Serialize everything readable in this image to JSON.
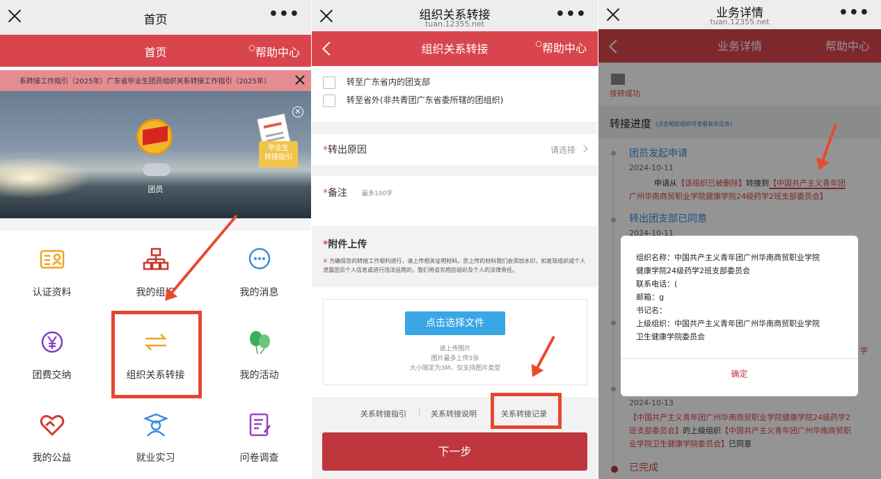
{
  "left": {
    "title": "首页",
    "header": "首页",
    "help": "帮助中心",
    "notice": "系转接工作指引（2025年）广东省毕业生团员组织关系转接工作指引（2025年）",
    "user_role": "团员",
    "promo_line1": "毕业生",
    "promo_line2": "转接指引",
    "menu": [
      {
        "label": "认证资料"
      },
      {
        "label": "我的组织"
      },
      {
        "label": "我的消息"
      },
      {
        "label": "团费交纳"
      },
      {
        "label": "组织关系转接"
      },
      {
        "label": "我的活动"
      },
      {
        "label": "我的公益"
      },
      {
        "label": "就业实习"
      },
      {
        "label": "问卷调查"
      }
    ]
  },
  "middle": {
    "title": "组织关系转接",
    "url": "tuan.12355.net",
    "header": "组织关系转接",
    "help": "帮助中心",
    "opt1": "转至广东省内的团支部",
    "opt2": "转至省外(非共青团广东省委所辖的团组织)",
    "reason_label": "转出原因",
    "reason_placeholder": "请选择",
    "remark_label": "备注",
    "remark_hint": "最多100字",
    "attach_title": "附件上传",
    "attach_note": "为确保您的转接工作顺利进行，请上传相关证明材料。您上传的材料我们会添加水印，如发现组织或个人泄露团员个人信息或进行违法运用的，我们将追究相应组织及个人的法律责任。",
    "select_btn": "点击选择文件",
    "upload_hint1": "请上传图片",
    "upload_hint2": "图片最多上传5张",
    "upload_hint3": "大小限定为3M，仅支持图片类型",
    "link1": "关系转接指引",
    "link2": "关系转接说明",
    "link3": "关系转接记录",
    "next": "下一步"
  },
  "right": {
    "title": "业务详情",
    "url": "tuan.12355.net",
    "header": "业务详情",
    "help": "帮助中心",
    "status": "接转成功",
    "progress_title": "转接进度",
    "progress_hint": "(点击相应组织可查看联系信息)",
    "step1": "团员发起申请",
    "step1_date": "2024-10-11",
    "step1_text_a": "申请从",
    "step1_text_b": "【该组织已被删除】",
    "step1_text_c": "转接到",
    "step1_text_d": "【中国共产主义青年团",
    "step1_text_e": "广州华南商贸职业学院健康学院24级药学2班支部委员会】",
    "step2": "转出团支部已同意",
    "step2_date": "2024-10-11",
    "peek": "学",
    "dlg_l1": "组织名称：中国共产主义青年团广州华南商贸职业学院",
    "dlg_l2": "健康学院24级药学2班支部委员会",
    "dlg_l3": "联系电话：(",
    "dlg_l4": "邮箱：g",
    "dlg_l5": "书记名：",
    "dlg_l6": "上级组织：中国共产主义青年团广州华南商贸职业学院",
    "dlg_l7": "卫生健康学院委员会",
    "dlg_ok": "确定",
    "step_date3": "2024-10-13",
    "step3_text_a": "【中国共产主义青年团广州华南商贸职业学院健康学院24级药学2",
    "step3_text_b": "班支部委员会】",
    "step3_text_c": "的上级组织",
    "step3_text_d": "【中国共产主义青年团广州华南商贸职",
    "step3_text_e": "业学院卫生健康学院委员会】",
    "step3_text_f": "已同意",
    "done": "已完成"
  }
}
